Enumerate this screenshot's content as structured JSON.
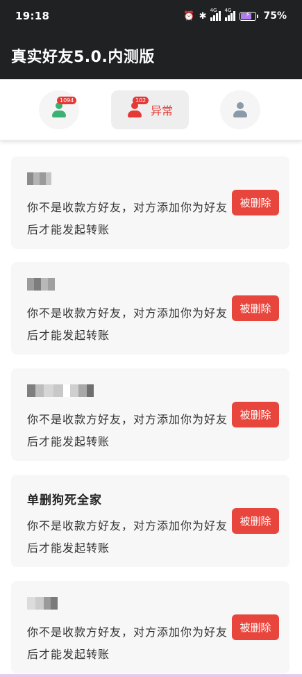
{
  "status_bar": {
    "time": "19:18",
    "signal_1_label": "4G",
    "signal_2_label": "4G",
    "battery_percent": "75%",
    "battery_level": 0.75
  },
  "app_bar": {
    "title": "真实好友5.0.内测版"
  },
  "tabs": [
    {
      "name": "friends",
      "badge": "1094",
      "label": "",
      "icon": "person-icon",
      "color": "#3bb273"
    },
    {
      "name": "abnormal",
      "badge": "102",
      "label": "异常",
      "icon": "person-icon",
      "color": "#e53935",
      "selected": true
    },
    {
      "name": "me",
      "badge": "",
      "label": "",
      "icon": "person-icon",
      "color": "#8a9aa8"
    }
  ],
  "list": {
    "items": [
      {
        "name": "",
        "message": "你不是收款方好友，对方添加你为好友后才能发起转账",
        "action": "被删除"
      },
      {
        "name": "",
        "message": "你不是收款方好友，对方添加你为好友后才能发起转账",
        "action": "被删除"
      },
      {
        "name": "",
        "message": "你不是收款方好友，对方添加你为好友后才能发起转账",
        "action": "被删除"
      },
      {
        "name": "单删狗死全家",
        "message": "你不是收款方好友，对方添加你为好友后才能发起转账",
        "action": "被删除"
      },
      {
        "name": "",
        "message": "你不是收款方好友，对方添加你为好友后才能发起转账",
        "action": "被删除"
      }
    ]
  },
  "colors": {
    "header_bg": "#1f2123",
    "accent_red": "#e8453c",
    "card_bg": "#f7f7f7"
  }
}
